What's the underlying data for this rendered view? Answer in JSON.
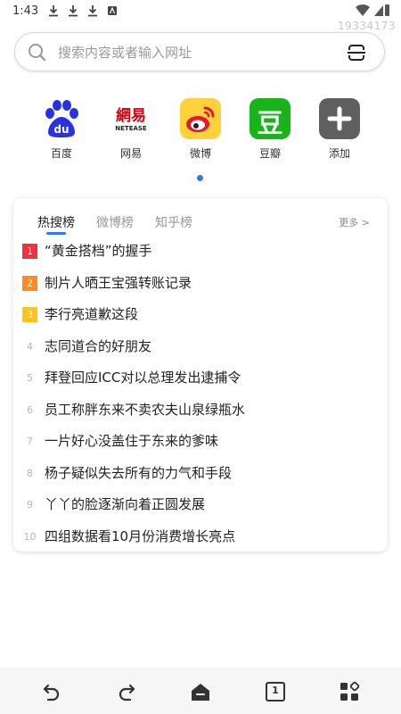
{
  "status_bar": {
    "time": "1:43",
    "watermark": "19334173"
  },
  "search": {
    "placeholder": "搜索内容或者输入网址"
  },
  "shortcuts": [
    {
      "label": "百度",
      "icon": "baidu-icon",
      "color": "#2932e1"
    },
    {
      "label": "网易",
      "icon": "netease-icon",
      "color": "#d7000f"
    },
    {
      "label": "微博",
      "icon": "weibo-icon",
      "color": "#ffd13b"
    },
    {
      "label": "豆瓣",
      "icon": "douban-icon",
      "color": "#19b31c"
    },
    {
      "label": "添加",
      "icon": "add-icon",
      "color": "#5f5f5f"
    }
  ],
  "netease_logo": {
    "cn": "網易",
    "en": "NETEASE"
  },
  "douban_logo": "豆",
  "hot": {
    "tabs": [
      "热搜榜",
      "微博榜",
      "知乎榜"
    ],
    "more": "更多 >",
    "rank_colors": [
      "#f4323d",
      "#ff8a1e",
      "#ffc51c"
    ],
    "items": [
      {
        "rank": "1",
        "title": "“黄金搭档”的握手"
      },
      {
        "rank": "2",
        "title": "制片人晒王宝强转账记录"
      },
      {
        "rank": "3",
        "title": "李行亮道歉这段"
      },
      {
        "rank": "4",
        "title": "志同道合的好朋友"
      },
      {
        "rank": "5",
        "title": "拜登回应ICC对以总理发出逮捕令"
      },
      {
        "rank": "6",
        "title": "员工称胖东来不卖农夫山泉绿瓶水"
      },
      {
        "rank": "7",
        "title": "一片好心没盖住于东来的爹味"
      },
      {
        "rank": "8",
        "title": "杨子疑似失去所有的力气和手段"
      },
      {
        "rank": "9",
        "title": "丫丫的脸逐渐向着正圆发展"
      },
      {
        "rank": "10",
        "title": "四组数据看10月份消费增长亮点"
      }
    ]
  },
  "bottom_bar": {
    "tab_count": "1",
    "icons": [
      "back-icon",
      "forward-icon",
      "home-icon",
      "tabs-icon",
      "menu-icon"
    ]
  }
}
